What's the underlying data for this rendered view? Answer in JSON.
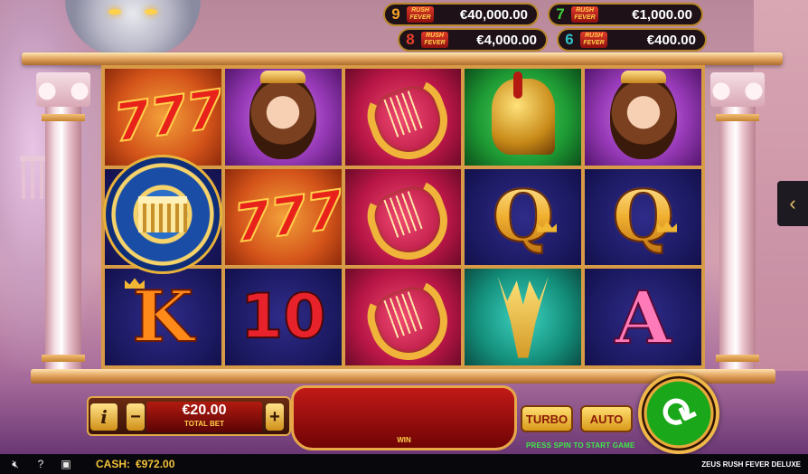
{
  "jackpots": [
    {
      "count": "9",
      "badge": "RUSH FEVER",
      "value": "€40,000.00",
      "color": "#f2a22a"
    },
    {
      "count": "7",
      "badge": "RUSH FEVER",
      "value": "€1,000.00",
      "color": "#3fcf3a"
    },
    {
      "count": "8",
      "badge": "RUSH FEVER",
      "value": "€4,000.00",
      "color": "#e8402a"
    },
    {
      "count": "6",
      "badge": "RUSH FEVER",
      "value": "€400.00",
      "color": "#2fc1c8"
    }
  ],
  "reels": [
    [
      "sevens",
      "scatter-temple",
      "king-K"
    ],
    [
      "goddess",
      "sevens",
      "ten-10"
    ],
    [
      "lyre",
      "lyre",
      "lyre"
    ],
    [
      "helmet",
      "queen-Q",
      "trident"
    ],
    [
      "goddess",
      "queen-Q",
      "ace-A"
    ]
  ],
  "symbols": {
    "sevens": "777",
    "ten": "10",
    "king": "K",
    "queen": "Q",
    "ace": "A"
  },
  "controls": {
    "info_label": "i",
    "minus_label": "−",
    "plus_label": "+",
    "bet_value": "€20.00",
    "bet_label": "TOTAL BET",
    "win_label": "WIN",
    "turbo_label": "TURBO",
    "auto_label": "AUTO",
    "spin_icon": "refresh-arrows-icon",
    "hint": "PRESS SPIN TO START GAME"
  },
  "side_arrow": "‹",
  "footer": {
    "sound_icon": "speaker-mute-icon",
    "help_icon": "?",
    "menu_icon": "screen-icon",
    "cash_label": "CASH:",
    "cash_value": "€972.00",
    "game_name": "ZEUS RUSH FEVER DELUXE"
  }
}
